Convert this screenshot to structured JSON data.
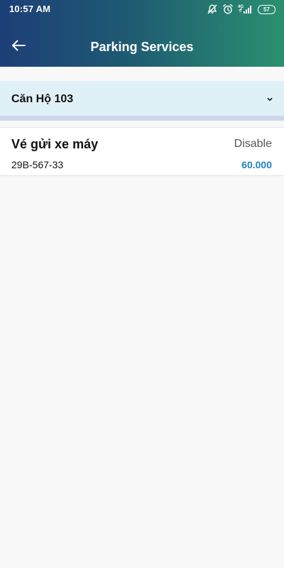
{
  "status_bar": {
    "time": "10:57 AM",
    "network_label": "4G",
    "battery_level": "57",
    "icons": [
      "notification-off-icon",
      "alarm-icon",
      "signal-icon",
      "battery-icon"
    ]
  },
  "header": {
    "title": "Parking Services",
    "back_icon": "arrow-left-icon",
    "gradient_colors": [
      "#1d3f77",
      "#2a9070"
    ]
  },
  "apartment_selector": {
    "selected_value": "Căn Hộ 103",
    "icon": "chevron-down-icon",
    "background_color": "#e0f0f7"
  },
  "services": [
    {
      "name": "Vé gửi xe máy",
      "status": "Disable",
      "plate": "29B-567-33",
      "price": "60.000",
      "price_color": "#1f82c2"
    }
  ]
}
